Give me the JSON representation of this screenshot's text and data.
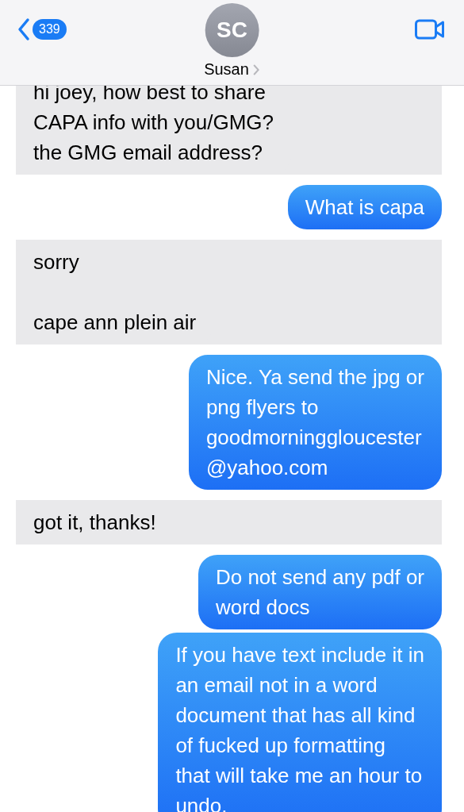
{
  "header": {
    "back_count": "339",
    "avatar_initials": "SC",
    "contact_name": "Susan"
  },
  "messages": [
    {
      "kind": "received",
      "text": "hi joey, how best to share\nCAPA info with you/GMG?\nthe GMG email address?"
    },
    {
      "kind": "sent",
      "text": "What is capa"
    },
    {
      "kind": "received",
      "text": "sorry\n\ncape ann plein air"
    },
    {
      "kind": "sent",
      "text": "Nice. Ya send the jpg or\npng flyers to\ngoodmorninggloucester\n@yahoo.com"
    },
    {
      "kind": "received",
      "text": "got it, thanks!"
    },
    {
      "kind": "sent",
      "text": "Do not send any pdf or\nword docs"
    },
    {
      "kind": "sent",
      "text": "If you have text include it in\nan email not in a word\ndocument that has all kind\nof fucked up formatting\nthat will take me an hour to\nundo."
    }
  ]
}
